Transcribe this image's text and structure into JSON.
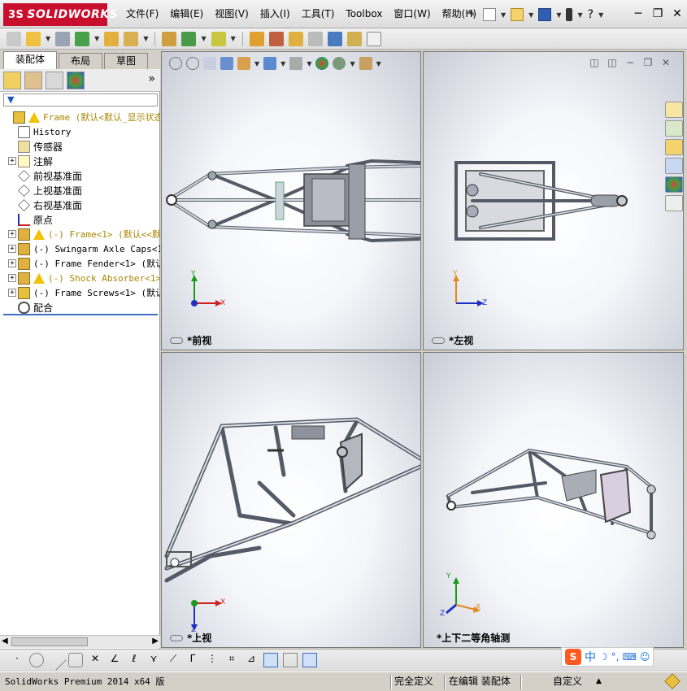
{
  "app": {
    "brand": "SOLIDWORKS",
    "brand_prefix": "3S"
  },
  "menu": {
    "items": [
      "文件(F)",
      "编辑(E)",
      "视图(V)",
      "插入(I)",
      "工具(T)",
      "Toolbox",
      "窗口(W)",
      "帮助(H)"
    ],
    "help_glyph": "?"
  },
  "left_panel": {
    "tabs": [
      "装配体",
      "布局",
      "草图"
    ],
    "active_tab": "装配体",
    "more_glyph": "»",
    "filter_glyph": "▼"
  },
  "tree": [
    {
      "label": "Frame  (默认<默认_显示状态",
      "expand": "",
      "icon": "assembly",
      "warning": true,
      "cn": false,
      "warned": true,
      "indent": 0
    },
    {
      "label": "History",
      "expand": "",
      "icon": "history",
      "warning": false,
      "cn": false,
      "warned": false,
      "indent": 1
    },
    {
      "label": "传感器",
      "expand": "",
      "icon": "sensor",
      "warning": false,
      "cn": true,
      "warned": false,
      "indent": 1
    },
    {
      "label": "注解",
      "expand": "+",
      "icon": "annotation",
      "warning": false,
      "cn": true,
      "warned": false,
      "indent": 1
    },
    {
      "label": "前视基准面",
      "expand": "",
      "icon": "plane",
      "warning": false,
      "cn": true,
      "warned": false,
      "indent": 1
    },
    {
      "label": "上视基准面",
      "expand": "",
      "icon": "plane",
      "warning": false,
      "cn": true,
      "warned": false,
      "indent": 1
    },
    {
      "label": "右视基准面",
      "expand": "",
      "icon": "plane",
      "warning": false,
      "cn": true,
      "warned": false,
      "indent": 1
    },
    {
      "label": "原点",
      "expand": "",
      "icon": "origin",
      "warning": false,
      "cn": true,
      "warned": false,
      "indent": 1
    },
    {
      "label": "(-) Frame<1> (默认<<默认",
      "expand": "+",
      "icon": "part",
      "warning": true,
      "cn": false,
      "warned": true,
      "indent": 1
    },
    {
      "label": "(-) Swingarm Axle Caps<1>",
      "expand": "+",
      "icon": "part",
      "warning": false,
      "cn": false,
      "warned": false,
      "indent": 1
    },
    {
      "label": "(-) Frame Fender<1> (默认",
      "expand": "+",
      "icon": "part",
      "warning": false,
      "cn": false,
      "warned": false,
      "indent": 1
    },
    {
      "label": "(-) Shock Absorber<1>",
      "expand": "+",
      "icon": "part",
      "warning": true,
      "cn": false,
      "warned": true,
      "indent": 1
    },
    {
      "label": "(-) Frame Screws<1> (默认",
      "expand": "+",
      "icon": "assembly",
      "warning": false,
      "cn": false,
      "warned": false,
      "indent": 1
    },
    {
      "label": "配合",
      "expand": "",
      "icon": "mates",
      "warning": false,
      "cn": true,
      "warned": false,
      "indent": 1
    }
  ],
  "viewports": {
    "front": {
      "label": "*前视"
    },
    "left": {
      "label": "*左视"
    },
    "top": {
      "label": "*上视"
    },
    "iso": {
      "label": "*上下二等角轴测"
    }
  },
  "triad_axes": {
    "x": "X",
    "y": "Y",
    "z": "Z"
  },
  "ime": {
    "logo": "S",
    "lang": "中"
  },
  "status": {
    "app_version": "SolidWorks Premium 2014 x64 版",
    "definition": "完全定义",
    "editing": "在编辑 装配体",
    "units": "自定义",
    "caret": "▲"
  },
  "colors": {
    "brand_red": "#c8102e",
    "warning_yellow": "#f2c200",
    "frame_stroke": "#555a66",
    "axis_x": "#d02020",
    "axis_y": "#1a9a1a",
    "axis_z": "#2030c0"
  }
}
